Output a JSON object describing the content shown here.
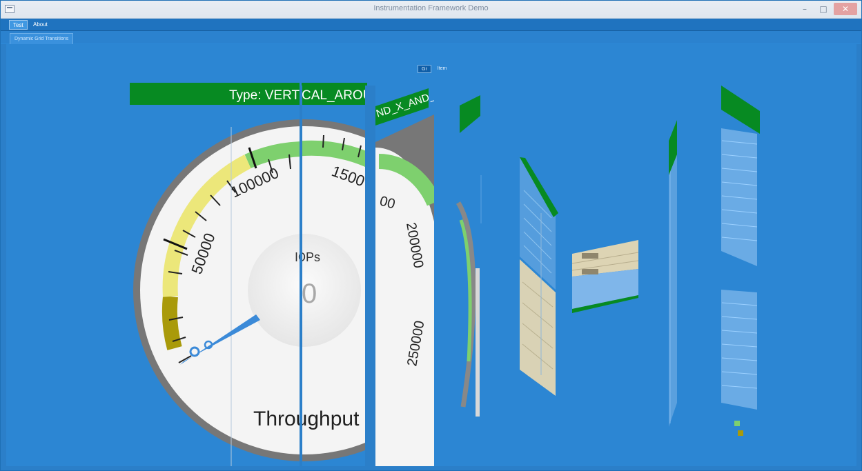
{
  "window": {
    "title": "Instrumentation Framework Demo",
    "controls": [
      "–",
      "□",
      "✕"
    ]
  },
  "menu": {
    "items": [
      "Test",
      "About"
    ]
  },
  "tabs": [
    {
      "label": "Dynamic Grid Transitions"
    }
  ],
  "view_switch": {
    "options": [
      "Gr",
      "Item"
    ],
    "active": "Gr"
  },
  "banner": {
    "part1": "Type: VERTI",
    "part2": "CAL_AROUN",
    "part3": "ND_X_AND_"
  },
  "gauge": {
    "unit": "IOPs",
    "value": "0",
    "name": "Throughput",
    "left_ticks": [
      "50000",
      "100000"
    ],
    "right_ticks": [
      "1500",
      "00",
      "200000",
      "250000"
    ]
  },
  "colors": {
    "background": "#2c86d3",
    "banner": "#078a22",
    "gauge_green": "#7ed06e",
    "gauge_yellow": "#ece77a",
    "gauge_olive": "#a99a0a",
    "needle": "#3b8ad8"
  }
}
